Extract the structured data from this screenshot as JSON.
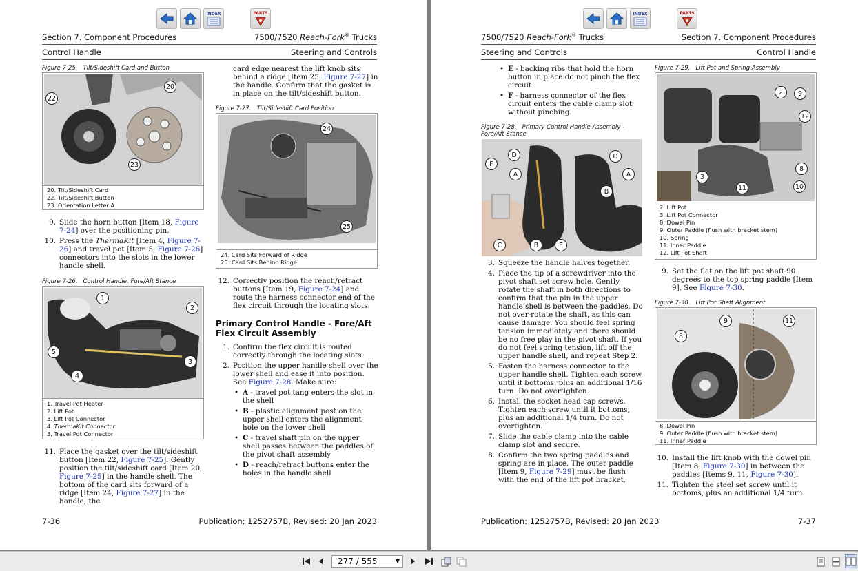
{
  "nav": {
    "back_icon": "back-arrow-icon",
    "home_icon": "home-icon",
    "index_label": "INDEX",
    "parts_label": "PARTS"
  },
  "left_page": {
    "header_left": "Section 7.  Component Procedures",
    "header_right_model": "7500/7520 ",
    "header_right_italic": "Reach-Fork",
    "header_right_reg": "®",
    "header_right_tail": " Trucks",
    "subheader_left": "Control Handle",
    "subheader_right": "Steering and Controls",
    "fig25": {
      "num": "Figure 7-25.",
      "title": "Tilt/Sideshift Card and Button",
      "callouts": [
        "20",
        "22",
        "23"
      ],
      "legend": [
        "20. Tilt/Sideshift Card",
        "22. Tilt/Sideshift Button",
        "23. Orientation Letter A"
      ]
    },
    "steps_a": [
      {
        "n": "9.",
        "t1": "Slide the horn button [Item 18, ",
        "link": "Figure 7-24",
        "t2": "] over the positioning pin."
      },
      {
        "n": "10.",
        "t1": "Press the ",
        "italic": "ThermaKit",
        "t2": " [Item 4, ",
        "link": "Figure 7-26",
        "t3": "] and travel pot [Item 5, ",
        "link2": "Figure 7-26",
        "t4": "] connectors into the slots in the lower handle shell."
      }
    ],
    "fig26": {
      "num": "Figure 7-26.",
      "title": "Control Handle, Fore/Aft Stance",
      "callouts": [
        "1",
        "2",
        "3",
        "4",
        "5"
      ],
      "legend": [
        "1. Travel Pot Heater",
        "2. Lift Pot",
        "3. Lift Pot Connector",
        "4. ThermaKit Connector",
        "5. Travel Pot Connector"
      ]
    },
    "step11": {
      "n": "11.",
      "t1": "Place the gasket over the tilt/sideshift button [Item 22, ",
      "link": "Figure 7-25",
      "t2": "]. Gently position the tilt/sideshift card [Item 20, ",
      "link2": "Figure 7-25",
      "t3": "] in the handle shell. The bottom of the card sits forward of a ridge [Item 24, ",
      "link3": "Figure 7-27",
      "t4": "] in the handle; the"
    },
    "col2_top": {
      "t1": "card edge nearest the lift knob sits behind a ridge [Item 25, ",
      "link": "Figure 7-27",
      "t2": "] in the handle. Confirm that the gasket is in place on the tilt/sideshift button."
    },
    "fig27": {
      "num": "Figure 7-27.",
      "title": "Tilt/Sideshift Card Position",
      "callouts": [
        "24",
        "25"
      ],
      "legend": [
        "24. Card Sits Forward of Ridge",
        "25. Card Sits Behind Ridge"
      ]
    },
    "step12": {
      "n": "12.",
      "t1": "Correctly position the reach/retract buttons [Item 19, ",
      "link": "Figure 7-24",
      "t2": "] and route the harness connector end of the flex circuit through the locating slots."
    },
    "section_heading": "Primary Control Handle - Fore/Aft Flex Circuit Assembly",
    "sec_steps": [
      {
        "n": "1.",
        "t1": "Confirm the flex circuit is routed correctly through the locating slots."
      },
      {
        "n": "2.",
        "t1": "Position the upper handle shell over the lower shell and ease it into position. See ",
        "link": "Figure 7-28",
        "t2": ". Make sure:"
      }
    ],
    "bullets": [
      {
        "b": "A",
        "t": " - travel pot tang enters the slot in the shell"
      },
      {
        "b": "B",
        "t": " - plastic alignment post on the upper shell enters the alignment hole on the lower shell"
      },
      {
        "b": "C",
        "t": " - travel shaft pin on the upper shell passes between the paddles of the pivot shaft assembly"
      },
      {
        "b": "D",
        "t": " - reach/retract buttons enter the holes in the handle shell"
      }
    ],
    "footer_left": "7-36",
    "footer_right": "Publication: 1252757B, Revised: 20 Jan 2023"
  },
  "right_page": {
    "header_left_model": "7500/7520 ",
    "header_left_italic": "Reach-Fork",
    "header_left_reg": "®",
    "header_left_tail": " Trucks",
    "header_right": "Section 7.  Component Procedures",
    "subheader_left": "Steering and Controls",
    "subheader_right": "Control Handle",
    "bullets": [
      {
        "b": "E",
        "t": " - backing ribs that hold the horn button in place do not pinch the flex circuit"
      },
      {
        "b": "F",
        "t": " - harness connector of the flex circuit enters the cable clamp slot without pinching."
      }
    ],
    "fig28": {
      "num": "Figure 7-28.",
      "title": "Primary Control Handle Assembly - Fore/Aft Stance",
      "callouts": [
        "D",
        "D",
        "F",
        "A",
        "A",
        "B",
        "C",
        "B",
        "E"
      ]
    },
    "steps": [
      {
        "n": "3.",
        "t1": "Squeeze the handle halves together."
      },
      {
        "n": "4.",
        "t1": "Place the tip of a screwdriver into the pivot shaft set screw hole. Gently rotate the shaft in both directions to confirm that the pin in the upper handle shell is between the paddles. Do not over-rotate the shaft, as this can cause damage. You should feel spring tension immediately and there should be no free play in the pivot shaft. If you do not feel spring tension, lift off the upper handle shell, and repeat Step 2."
      },
      {
        "n": "5.",
        "t1": "Fasten the harness connector to the upper handle shell. Tighten each screw until it bottoms, plus an additional 1/16 turn. Do not overtighten."
      },
      {
        "n": "6.",
        "t1": "Install the socket head cap screws. Tighten each screw until it bottoms, plus an additional 1/4 turn. Do not overtighten."
      },
      {
        "n": "7.",
        "t1": "Slide the cable clamp into the cable clamp slot and secure."
      },
      {
        "n": "8.",
        "t1": "Confirm the two spring paddles and spring are in place. The outer paddle [Item 9, ",
        "link": "Figure 7-29",
        "t2": "] must be flush with the end of the lift pot bracket."
      }
    ],
    "fig29": {
      "num": "Figure 7-29.",
      "title": "Lift Pot and Spring Assembly",
      "callouts": [
        "2",
        "9",
        "12",
        "8",
        "3",
        "11",
        "10"
      ],
      "legend": [
        "2. Lift Pot",
        "3. Lift Pot Connector",
        "8. Dowel Pin",
        "9. Outer Paddle (flush with bracket stem)",
        "10. Spring",
        "11. Inner Paddle",
        "12. Lift Pot Shaft"
      ]
    },
    "step9": {
      "n": "9.",
      "t1": "Set the flat on the lift pot shaft 90 degrees to the top spring paddle [Item 9]. See ",
      "link": "Figure 7-30",
      "t2": "."
    },
    "fig30": {
      "num": "Figure 7-30.",
      "title": "Lift Pot Shaft Alignment",
      "callouts": [
        "9",
        "11",
        "8"
      ],
      "legend": [
        "8. Dowel Pin",
        "9. Outer Paddle (flush with bracket stem)",
        "11. Inner Paddle"
      ]
    },
    "step10": {
      "n": "10.",
      "t1": "Install the lift knob with the dowel pin [Item 8, ",
      "link": "Figure 7-30",
      "t2": "] in between the paddles [Items 9, 11, ",
      "link2": "Figure 7-30",
      "t3": "]."
    },
    "step11": {
      "n": "11.",
      "t1": "Tighten the steel set screw until it bottoms, plus an additional 1/4 turn."
    },
    "footer_left": "Publication: 1252757B, Revised: 20 Jan 2023",
    "footer_right": "7-37"
  },
  "toolbar": {
    "page_value": "277 / 555",
    "icons": [
      "first-page-icon",
      "prev-page-icon",
      "next-page-icon",
      "last-page-icon",
      "go-back-icon",
      "go-forward-icon",
      "single-page-icon",
      "continuous-icon",
      "two-page-icon"
    ]
  }
}
